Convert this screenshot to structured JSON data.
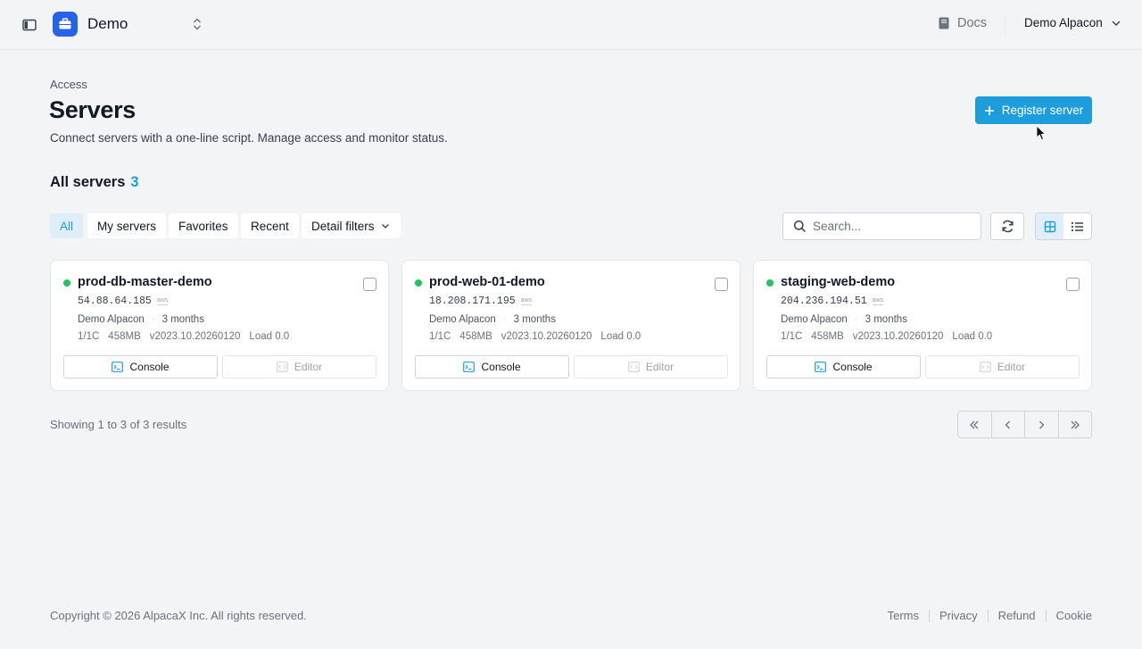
{
  "topbar": {
    "workspace": "Demo",
    "docs_label": "Docs",
    "user_name": "Demo Alpacon"
  },
  "header": {
    "breadcrumb": "Access",
    "title": "Servers",
    "subtitle": "Connect servers with a one-line script. Manage access and monitor status.",
    "register_label": "Register server"
  },
  "section": {
    "title": "All servers",
    "count": "3"
  },
  "filters": {
    "all": "All",
    "mine": "My servers",
    "favorites": "Favorites",
    "recent": "Recent",
    "detail": "Detail filters"
  },
  "search": {
    "placeholder": "Search..."
  },
  "servers": [
    {
      "name": "prod-db-master-demo",
      "ip": "54.88.64.185",
      "provider": "aws",
      "owner": "Demo Alpacon",
      "age": "3 months",
      "cpu": "1/1C",
      "memory": "458MB",
      "version": "v2023.10.20260120",
      "load": "Load 0.0",
      "console_label": "Console",
      "editor_label": "Editor"
    },
    {
      "name": "prod-web-01-demo",
      "ip": "18.208.171.195",
      "provider": "aws",
      "owner": "Demo Alpacon",
      "age": "3 months",
      "cpu": "1/1C",
      "memory": "458MB",
      "version": "v2023.10.20260120",
      "load": "Load 0.0",
      "console_label": "Console",
      "editor_label": "Editor"
    },
    {
      "name": "staging-web-demo",
      "ip": "204.236.194.51",
      "provider": "aws",
      "owner": "Demo Alpacon",
      "age": "3 months",
      "cpu": "1/1C",
      "memory": "458MB",
      "version": "v2023.10.20260120",
      "load": "Load 0.0",
      "console_label": "Console",
      "editor_label": "Editor"
    }
  ],
  "pagination": {
    "summary": "Showing 1 to 3 of 3 results"
  },
  "footer": {
    "copyright": "Copyright © 2026 AlpacaX Inc. All rights reserved.",
    "terms": "Terms",
    "privacy": "Privacy",
    "refund": "Refund",
    "cookie": "Cookie"
  },
  "colors": {
    "accent": "#1d9ddb",
    "logo": "#2563eb",
    "status_online": "#22c55e"
  }
}
